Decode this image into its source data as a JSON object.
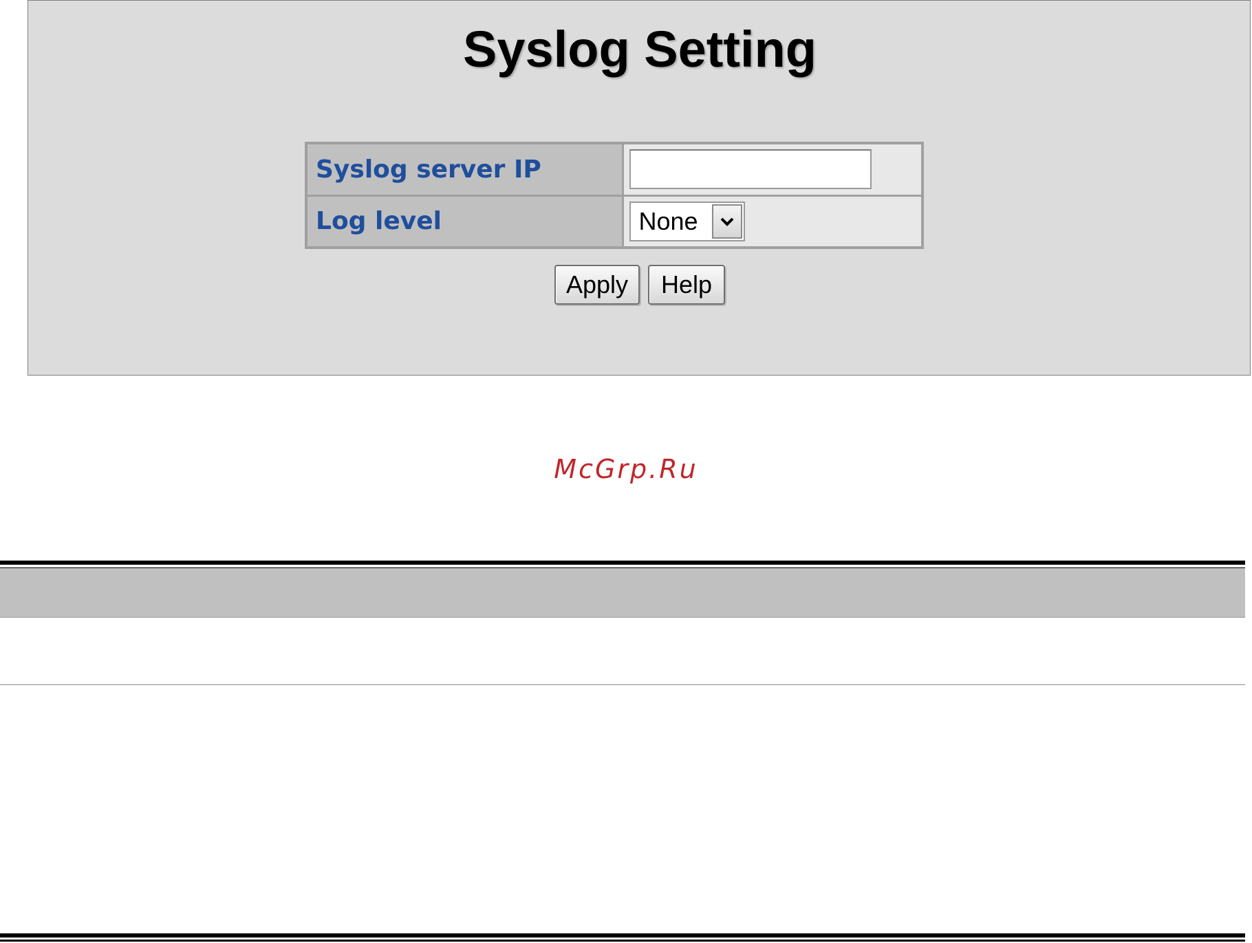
{
  "page": {
    "title": "Syslog Setting"
  },
  "form": {
    "server_ip": {
      "label": "Syslog server IP",
      "value": ""
    },
    "log_level": {
      "label": "Log level",
      "selected": "None"
    }
  },
  "buttons": {
    "apply_label": "Apply",
    "help_label": "Help"
  },
  "watermark": {
    "text": "McGrp.Ru"
  },
  "colors": {
    "label_text": "#1f4e9c",
    "panel_bg": "#dcdcdc",
    "watermark": "#c0262b"
  }
}
